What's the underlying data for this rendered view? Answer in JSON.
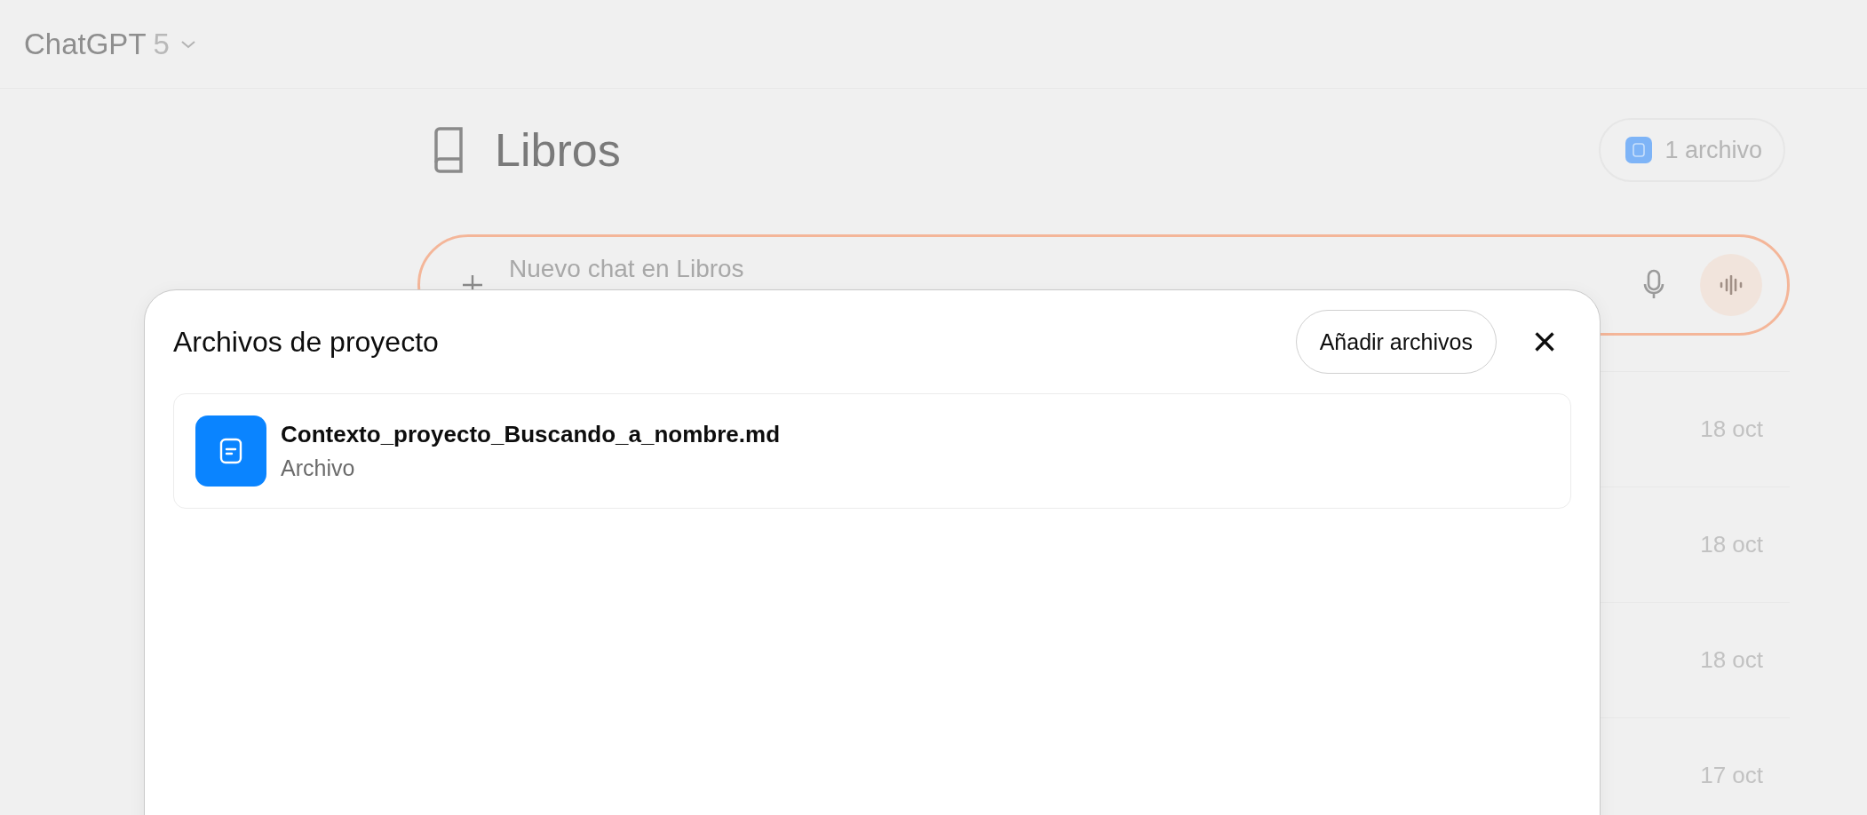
{
  "header": {
    "model_name": "ChatGPT",
    "model_version": "5"
  },
  "project": {
    "title": "Libros",
    "files_badge": "1 archivo"
  },
  "composer": {
    "placeholder": "Nuevo chat en Libros"
  },
  "chats": [
    {
      "date": "18 oct"
    },
    {
      "date": "18 oct"
    },
    {
      "date": "18 oct"
    },
    {
      "date": "17 oct"
    }
  ],
  "modal": {
    "title": "Archivos de proyecto",
    "add_button": "Añadir archivos",
    "close_label": "×",
    "files": [
      {
        "name": "Contexto_proyecto_Buscando_a_nombre.md",
        "type": "Archivo"
      }
    ]
  }
}
